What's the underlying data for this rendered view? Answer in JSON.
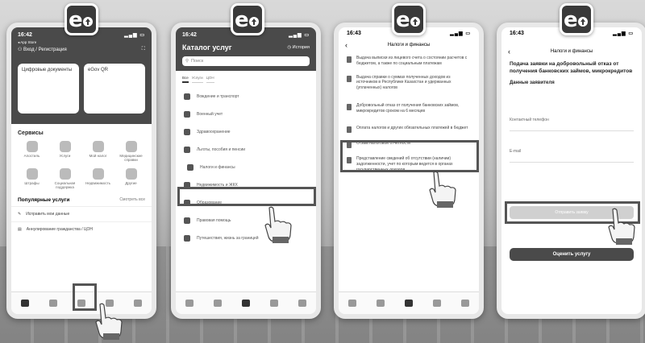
{
  "screens": [
    {
      "time": "16:42",
      "carrier": "◂ App Store",
      "login": "Вход / Регистрация",
      "cards": [
        "Цифровые документы",
        "eGov QR"
      ],
      "services_title": "Сервисы",
      "services": [
        "Апостиль",
        "Услуги",
        "Мой налог",
        "Медицинские справки",
        "Штрафы",
        "Социальная поддержка",
        "Недвижимость",
        "Другие"
      ],
      "popular_title": "Популярные услуги",
      "popular_all": "Смотреть все",
      "popular_items": [
        "Исправить мои данные",
        "Аннулирование гражданства / ЦОН"
      ]
    },
    {
      "time": "16:42",
      "title": "Каталог услуг",
      "history": "История",
      "search_placeholder": "Поиск",
      "chips": [
        "Все",
        "Услуги",
        "ЦОН"
      ],
      "categories": [
        "Вождение и транспорт",
        "Военный учет",
        "Здравоохранение",
        "Льготы, пособия и пенсии",
        "Налоги и финансы",
        "Недвижимость и ЖКХ",
        "Образование",
        "Правовая помощь",
        "Путешествия, жизнь за границей"
      ]
    },
    {
      "time": "16:43",
      "title": "Налоги и финансы",
      "items": [
        "Выдача выписки из лицевого счета о состоянии расчетов с бюджетом, а также по социальным платежам",
        "Выдача справки о суммах полученных доходов из источников в Республике Казахстан и удержанных (уплаченных) налогов",
        "Добровольный отказ от получения банковских займов, микрокредитов сроком на 6 месяцев",
        "Оплата налогов и других обязательных платежей в бюджет",
        "Отзыв налоговой отчетности",
        "Представление сведений об отсутствии (наличии) задолженности, учет по которым ведется в органах государственных доходов"
      ]
    },
    {
      "time": "16:43",
      "title": "Налоги и финансы",
      "heading": "Подача заявки на добровольный отказ от получения банковских займов, микрокредитов",
      "subheading": "Данные заявителя",
      "phone_label": "Контактный телефон",
      "email_label": "E-mail",
      "light_button": "Отправить заявку",
      "rate_button": "Оценить услугу"
    }
  ]
}
